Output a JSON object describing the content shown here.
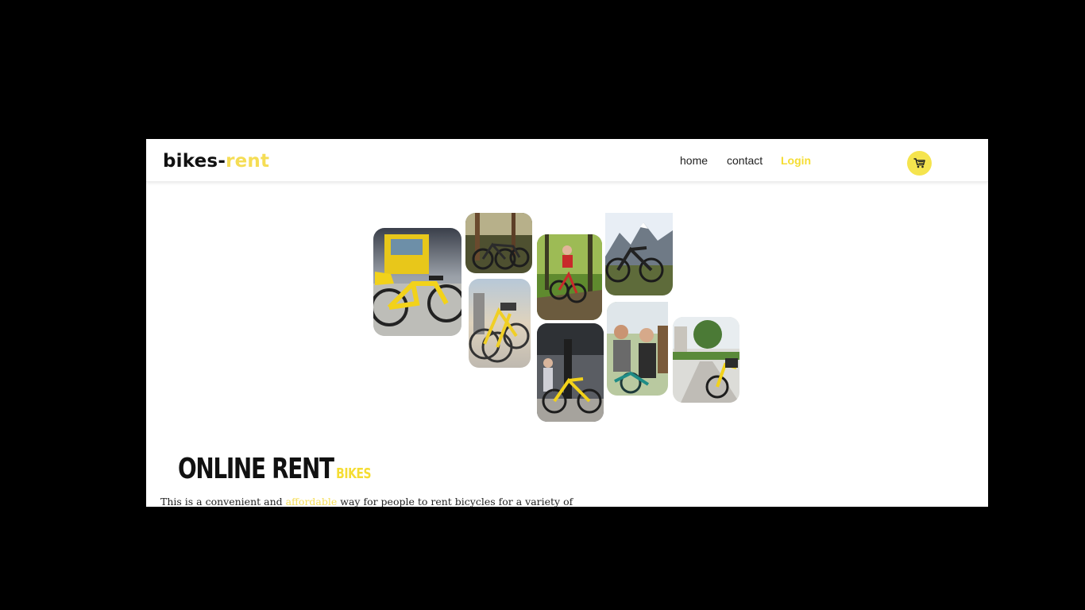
{
  "brand": {
    "name_part1": "bikes-",
    "name_part2": "rent",
    "accent_color": "#f5dd55"
  },
  "nav": {
    "home": "home",
    "contact": "contact",
    "login": "Login",
    "cart_icon": "shopping-cart-icon"
  },
  "gallery": {
    "images": [
      "yellow-bike-by-tram",
      "bikes-parked-in-forest",
      "yellow-bikes-parked-city",
      "cyclist-riding-forest-trail",
      "yellow-bike-street-city",
      "mountain-bike-alps",
      "group-of-cyclists",
      "yellow-bike-park-path"
    ]
  },
  "hero": {
    "title_main": "ONLINE RENT",
    "title_sub": "BIKES",
    "text_before": "This is a convenient and ",
    "text_highlight": "affordable",
    "text_after": " way for people to rent bicycles for a variety of"
  }
}
